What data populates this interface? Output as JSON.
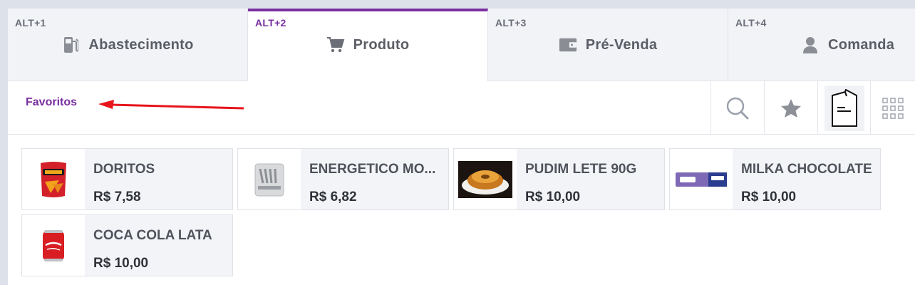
{
  "tabs": [
    {
      "shortcut": "ALT+1",
      "label": "Abastecimento",
      "icon": "fuel-pump-icon",
      "active": false
    },
    {
      "shortcut": "ALT+2",
      "label": "Produto",
      "icon": "shopping-cart-icon",
      "active": true
    },
    {
      "shortcut": "ALT+3",
      "label": "Pré-Venda",
      "icon": "wallet-icon",
      "active": false
    },
    {
      "shortcut": "ALT+4",
      "label": "Comanda",
      "icon": "user-icon",
      "active": false
    }
  ],
  "toolbar": {
    "section_label": "Favoritos",
    "tools": [
      "search-icon",
      "star-icon",
      "note-icon",
      "grid-icon"
    ]
  },
  "products": [
    {
      "name": "DORITOS",
      "price": "R$ 7,58",
      "image": "doritos-image"
    },
    {
      "name": "ENERGETICO MO...",
      "price": "R$ 6,82",
      "image": "monster-can-image"
    },
    {
      "name": "PUDIM LETE 90G",
      "price": "R$ 10,00",
      "image": "pudim-image"
    },
    {
      "name": "MILKA CHOCOLATE",
      "price": "R$ 10,00",
      "image": "milka-bar-image"
    },
    {
      "name": "COCA COLA LATA",
      "price": "R$ 10,00",
      "image": "coca-cola-can-image"
    }
  ],
  "colors": {
    "accent": "#7a2fa0",
    "annotation_arrow": "#e8141b"
  }
}
